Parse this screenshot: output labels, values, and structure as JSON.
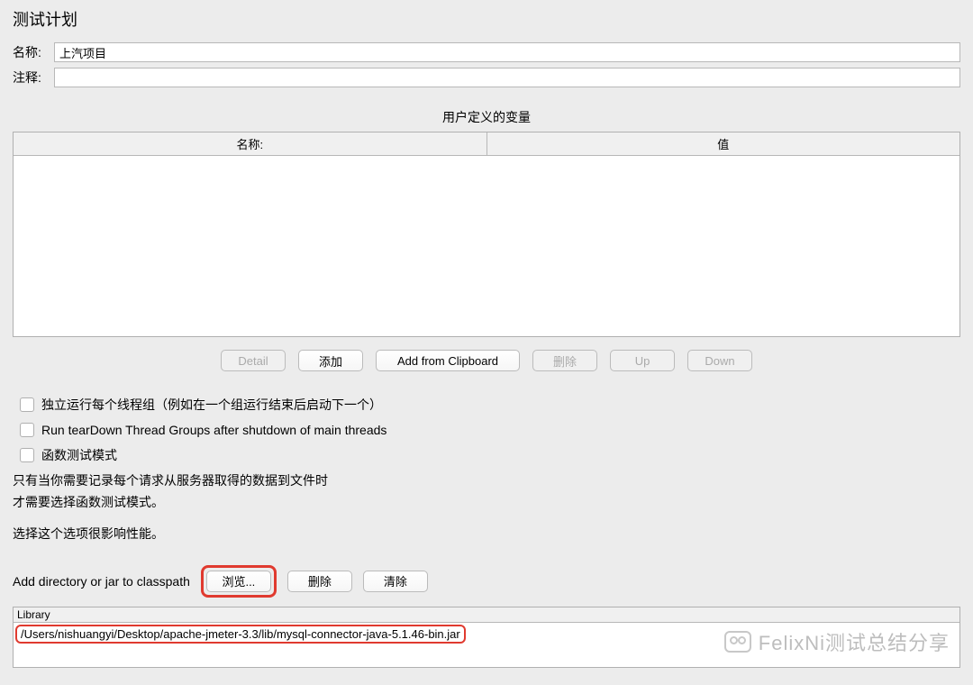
{
  "title": "测试计划",
  "fields": {
    "name_label": "名称:",
    "name_value": "上汽项目",
    "comment_label": "注释:",
    "comment_value": ""
  },
  "user_vars": {
    "section_title": "用户定义的变量",
    "columns": {
      "name": "名称:",
      "value": "值"
    },
    "rows": []
  },
  "var_buttons": {
    "detail": "Detail",
    "add": "添加",
    "add_clipboard": "Add from Clipboard",
    "delete": "删除",
    "up": "Up",
    "down": "Down"
  },
  "options": {
    "serialize": "独立运行每个线程组（例如在一个组运行结束后启动下一个）",
    "teardown": "Run tearDown Thread Groups after shutdown of main threads",
    "func_mode": "函数测试模式"
  },
  "notes": {
    "line1": "只有当你需要记录每个请求从服务器取得的数据到文件时",
    "line2": "才需要选择函数测试模式。",
    "line3": "选择这个选项很影响性能。"
  },
  "classpath": {
    "label": "Add directory or jar to classpath",
    "browse": "浏览...",
    "delete": "删除",
    "clear": "清除"
  },
  "library": {
    "header": "Library",
    "rows": [
      "/Users/nishuangyi/Desktop/apache-jmeter-3.3/lib/mysql-connector-java-5.1.46-bin.jar"
    ]
  },
  "watermark": "FelixNi测试总结分享"
}
